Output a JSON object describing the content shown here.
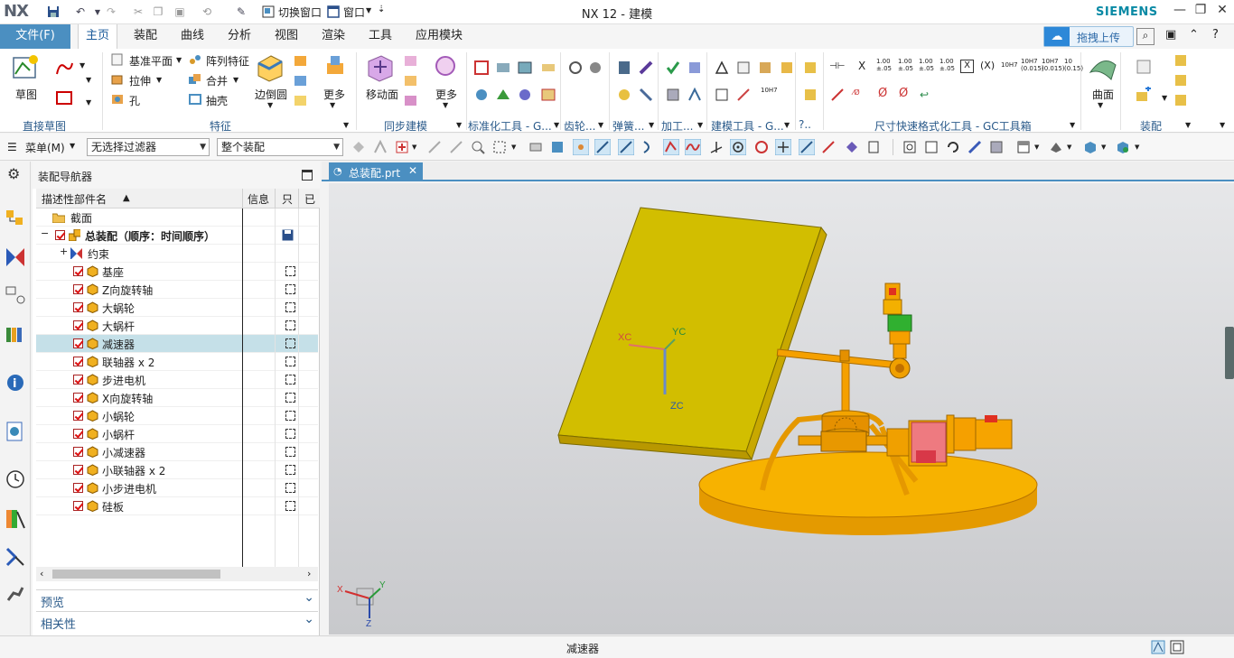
{
  "title_bar": {
    "logo": "NX",
    "title": "NX 12 - 建模",
    "brand": "SIEMENS",
    "switch_window": "切换窗口",
    "window_menu": "窗口"
  },
  "menu": {
    "file": "文件(F)",
    "tabs": [
      "主页",
      "装配",
      "曲线",
      "分析",
      "视图",
      "渲染",
      "工具",
      "应用模块"
    ],
    "active": "主页",
    "cloud_upload": "拖拽上传"
  },
  "ribbon": {
    "sketch": "草图",
    "direct_sketch_group": "直接草图",
    "datum_plane": "基准平面",
    "pattern_feature": "阵列特征",
    "extrude": "拉伸",
    "unite": "合并",
    "hole": "孔",
    "shell": "抽壳",
    "edge_blend": "边倒圆",
    "more1": "更多",
    "feature_group": "特征",
    "move_face": "移动面",
    "more2": "更多",
    "sync_group": "同步建模",
    "standard_tools_group": "标准化工具 - G...",
    "gear_group": "齿轮...",
    "spring_group": "弹簧...",
    "machining_group": "加工...",
    "build_tools_group": "建模工具 - G...",
    "misc_group": "?..",
    "dimension_group": "尺寸快速格式化工具 - GC工具箱",
    "surface": "曲面",
    "assembly_group": "装配"
  },
  "toolbar": {
    "menu": "菜单(M)",
    "filter": "无选择过滤器",
    "scope": "整个装配"
  },
  "navigator": {
    "title": "装配导航器",
    "col_name": "描述性部件名",
    "col_info": "信息",
    "col_ro": "只",
    "col_mod": "已",
    "section": "截面",
    "root": "总装配（顺序：时间顺序）",
    "constraints": "约束",
    "parts": [
      "基座",
      "Z向旋转轴",
      "大蜗轮",
      "大蜗杆",
      "减速器",
      "联轴器 x 2",
      "步进电机",
      "X向旋转轴",
      "小蜗轮",
      "小蜗杆",
      "小减速器",
      "小联轴器 x 2",
      "小步进电机",
      "硅板"
    ],
    "selected": "减速器",
    "preview": "预览",
    "dependencies": "相关性"
  },
  "document": {
    "tab": "总装配.prt"
  },
  "viewport": {
    "axis_x": "XC",
    "axis_y": "YC",
    "axis_z": "ZC",
    "triad_x": "X",
    "triad_y": "Y",
    "triad_z": "Z"
  },
  "status": {
    "text": "减速器"
  },
  "colors": {
    "accent": "#4b8fc1",
    "panel": "#d4bf00",
    "model": "#f5a000",
    "motor": "#e8707a"
  }
}
